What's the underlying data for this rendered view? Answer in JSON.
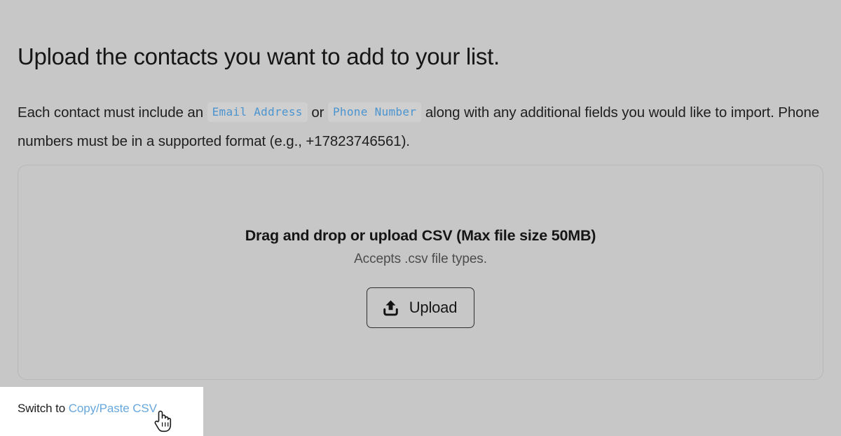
{
  "page": {
    "background_color": "#c7c7c7",
    "heading": "Upload the contacts you want to add to your list.",
    "intro": {
      "part1": "Each contact must include an",
      "chip1": "Email Address",
      "conjunction": "or",
      "chip2": "Phone Number",
      "part2": "along with any additional fields you would like to import. Phone numbers must be in a supported format (e.g., +17823746561).",
      "chip_text_color": "#4b94cf",
      "chip_background_color": "#cfcfcf"
    }
  },
  "dropzone": {
    "title": "Drag and drop or upload CSV (Max file size 50MB)",
    "subtitle": "Accepts .csv file types.",
    "max_file_size": "50MB",
    "accepted_types": ".csv",
    "upload_button": {
      "label": "Upload",
      "icon": "upload-icon"
    },
    "border_color": "#b8b8b8"
  },
  "footer": {
    "switch_prefix": "Switch to",
    "switch_link": "Copy/Paste CSV",
    "link_color": "#68a7dd",
    "panel_background": "#ffffff"
  },
  "cursor": {
    "type": "pointer-hand"
  }
}
